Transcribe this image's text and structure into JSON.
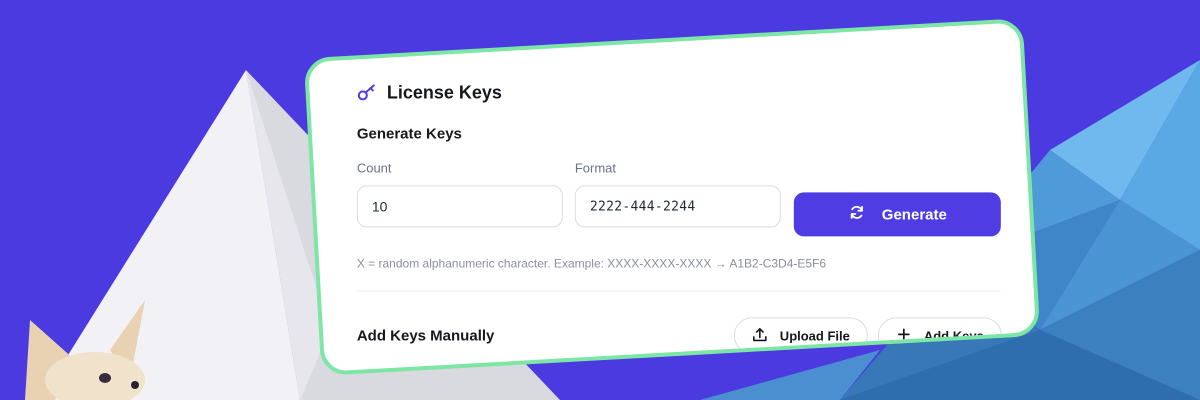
{
  "license": {
    "title": "License Keys",
    "generate": {
      "heading": "Generate Keys",
      "count_label": "Count",
      "count_value": "10",
      "format_label": "Format",
      "format_value": "2222-444-2244",
      "button_label": "Generate",
      "hint": "X = random alphanumeric character. Example: XXXX-XXXX-XXXX → A1B2-C3D4-E5F6"
    },
    "manual": {
      "heading": "Add Keys Manually",
      "upload_label": "Upload File",
      "add_label": "Add Keys"
    }
  },
  "colors": {
    "background": "#4b3ae0",
    "accent": "#4f3de3",
    "card_border": "#7de6a5"
  },
  "icons": [
    "key-icon",
    "refresh-icon",
    "upload-icon",
    "plus-icon"
  ]
}
